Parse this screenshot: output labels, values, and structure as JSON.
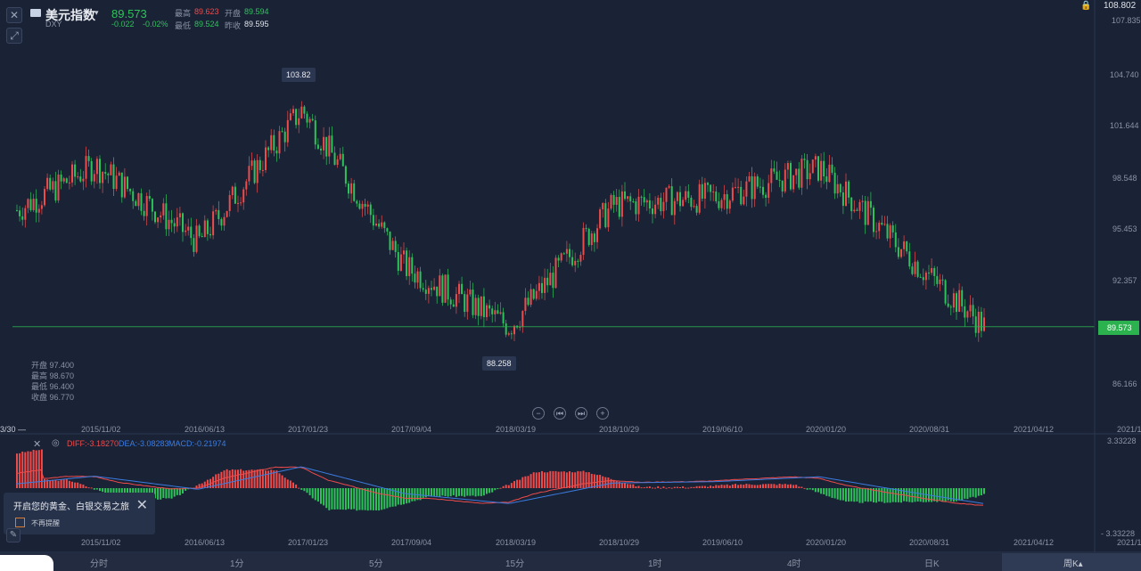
{
  "header": {
    "title": "美元指数",
    "symbol": "DXY",
    "price": "89.573",
    "change": "-0.022",
    "change_pct": "-0.02%",
    "high_label": "最高",
    "high_value": "89.623",
    "open_label": "开盘",
    "open_value": "89.594",
    "low_label": "最低",
    "low_value": "89.524",
    "prev_close_label": "昨收",
    "prev_close_value": "89.595",
    "top_right_price": "108.802"
  },
  "y_axis_labels": [
    "107.835",
    "104.740",
    "101.644",
    "98.548",
    "95.453",
    "92.357",
    "86.166"
  ],
  "last_price_tag": "89.573",
  "high_marker": "103.82",
  "low_marker": "88.258",
  "ohlc_info": [
    "开盘 97.400",
    "最高 98.670",
    "最低 96.400",
    "收盘 96.770"
  ],
  "x_axis_labels": [
    "2015/11/02",
    "2016/06/13",
    "2017/01/23",
    "2017/09/04",
    "2018/03/19",
    "2018/10/29",
    "2019/06/10",
    "2020/01/20",
    "2020/08/31",
    "2021/04/12"
  ],
  "x_axis_left_fragment": "3/30 —",
  "x_axis_right_fragment": "2021/1",
  "macd": {
    "diff_label": "DIFF:-3.18270",
    "dea_label": "DEA:-3.08283",
    "macd_label": "MACD:-0.21974",
    "top_scale": "3.33228",
    "bottom_scale": "- 3.33228",
    "right_fragment": "2021/1"
  },
  "nav_buttons": [
    "−",
    "⏮",
    "⏭",
    "+"
  ],
  "timeframes": [
    "分时",
    "1分",
    "5分",
    "15分",
    "1时",
    "4时",
    "日K",
    "周K▴"
  ],
  "popup": {
    "title": "开启您的黄金、白银交易之旅",
    "checkbox_label": "不再提醒"
  },
  "colors": {
    "background": "#1a2235",
    "up": "#ee4b4b",
    "down": "#2ec25b",
    "diff_line": "#ee4b4b",
    "dea_line": "#3b7ce0",
    "last_price_line": "#2cb14f"
  },
  "chart_data": {
    "type": "candlestick",
    "title": "美元指数",
    "x": [
      "2015/11/02",
      "2016/06/13",
      "2017/01/23",
      "2017/09/04",
      "2018/03/19",
      "2018/10/29",
      "2019/06/10",
      "2020/01/20",
      "2020/08/31",
      "2021/04/12"
    ],
    "ylim": [
      86.166,
      107.835
    ],
    "series": [
      {
        "close_path_x": [
          "2015/11/02",
          "2016/06/13",
          "2017/01/23",
          "2017/09/04",
          "2018/03/19",
          "2018/10/29",
          "2019/06/10",
          "2020/01/20",
          "2020/08/31"
        ],
        "close_path_values": [
          99.2,
          94.6,
          102.5,
          93.1,
          89.6,
          96.8,
          97.3,
          99.0,
          92.9
        ]
      }
    ],
    "last_price": 89.573,
    "period_high": 103.82,
    "period_low": 88.258
  }
}
